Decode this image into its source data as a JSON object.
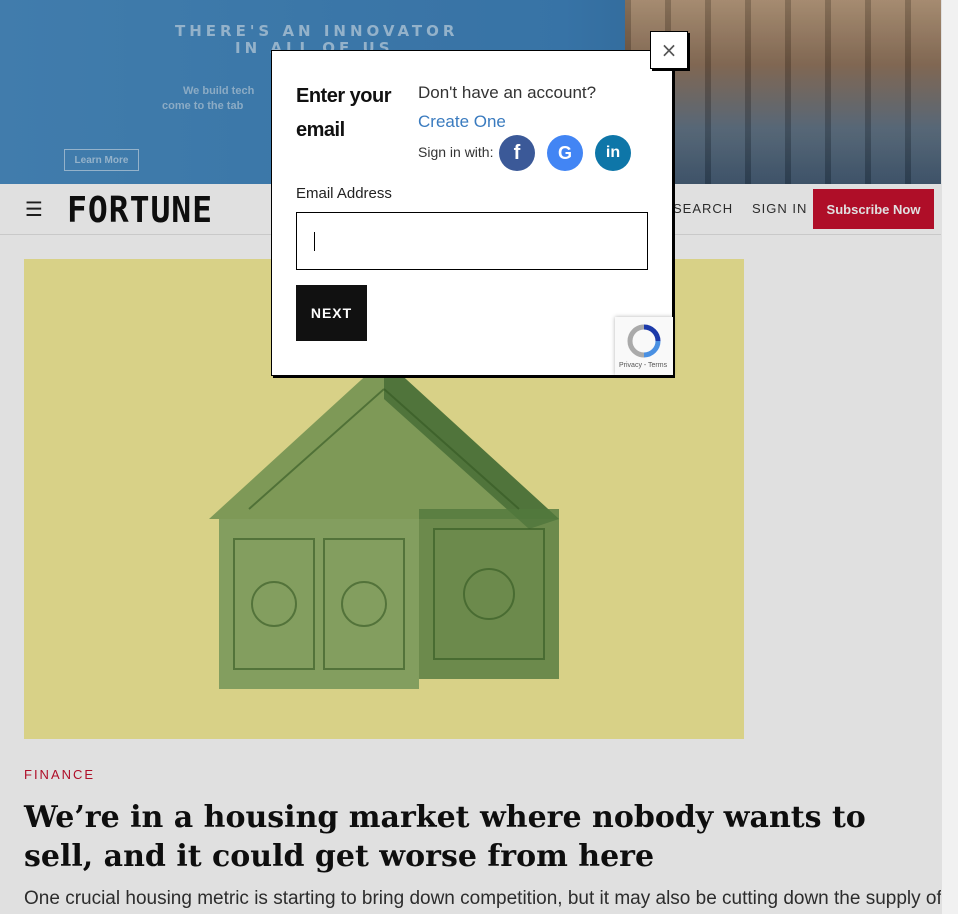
{
  "ad": {
    "headline_line1": "THERE'S AN INNOVATOR",
    "headline_line2": "IN ALL OF US",
    "subtext_line1": "We build tech",
    "subtext_line2": "come to the tab",
    "cta": "Learn More"
  },
  "navbar": {
    "menu_icon": "☰",
    "logo": "FORTUNE",
    "search_label": "SEARCH",
    "signin_label": "SIGN IN",
    "subscribe_label": "Subscribe Now"
  },
  "article": {
    "category": "FINANCE",
    "headline": "We’re in a housing market where nobody wants to sell, and it could get worse from here",
    "subhead": "One crucial housing metric is starting to bring down competition, but it may also be cutting down the supply of homes on"
  },
  "modal": {
    "close_label": "×",
    "title": "Enter your email",
    "account_prompt": "Don't have an account?",
    "create_link": "Create One",
    "signin_with": "Sign in with:",
    "social": [
      {
        "name": "facebook",
        "glyph": "f"
      },
      {
        "name": "google",
        "glyph": "G"
      },
      {
        "name": "linkedin",
        "glyph": "in"
      }
    ],
    "email_label": "Email Address",
    "email_value": "",
    "next_label": "NEXT",
    "recaptcha_links": "Privacy - Terms"
  },
  "colors": {
    "brand_red": "#c8102e",
    "link_blue": "#3a7bbf",
    "hero_bg": "#f6ee9a"
  }
}
